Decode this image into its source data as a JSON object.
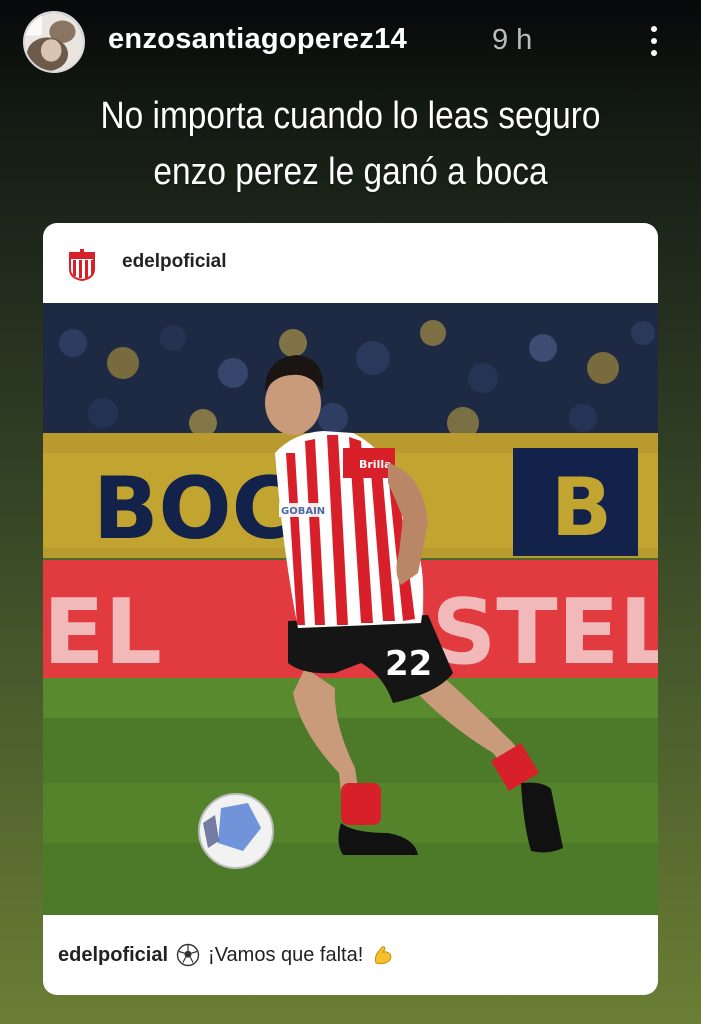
{
  "story": {
    "username": "enzosantiagoperez14",
    "time": "9 h",
    "caption_lines": [
      "No importa cuando lo leas seguro",
      "enzo perez le ganó a boca"
    ]
  },
  "post": {
    "author": "edelpoficial",
    "caption": "¡Vamos que falta!",
    "photo": {
      "banner_texts": [
        "BOC",
        "B",
        "EL",
        "ISTEL"
      ],
      "sponsor_left": "Brilla",
      "sponsor_chest": "GOBAIN",
      "shorts_number": "22"
    }
  },
  "icons": {
    "more": "more-vertical-icon",
    "ball": "soccer-ball-icon",
    "muscle": "flexed-biceps-icon",
    "club": "estudiantes-crest-icon"
  },
  "colors": {
    "background_top": "#07090a",
    "background_bottom": "#6b7e35",
    "card": "#ffffff",
    "jersey_red": "#d8202a"
  }
}
